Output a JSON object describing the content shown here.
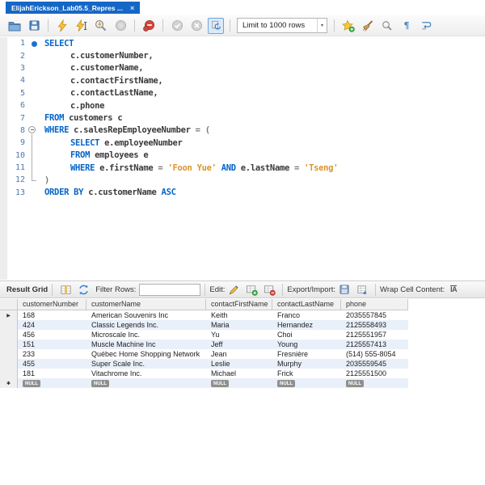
{
  "colors": {
    "tab_blue": "#1567c5",
    "keyword_blue": "#0564c8",
    "string_orange": "#d9952f",
    "alt_row_blue": "#e9f0fa",
    "lightning_yellow": "#f8c93f",
    "null_badge_gray": "#8f8f8f"
  },
  "tab": {
    "title": "ElijahErickson_Lab05.5_Repres ...",
    "close_glyph": "×"
  },
  "main_toolbar": {
    "limit_dropdown": {
      "value": "Limit to 1000 rows",
      "arrow_glyph": "▾"
    },
    "pilcrow_glyph": "¶",
    "icons": [
      "open-script-icon",
      "save-script-icon",
      "execute-icon",
      "execute-current-icon",
      "explain-icon",
      "stop-icon",
      "toggle-stop-on-error-icon",
      "commit-icon",
      "rollback-icon",
      "toggle-autocommit-icon",
      "save-snippet-icon",
      "beautify-icon",
      "find-icon",
      "show-invisibles-icon",
      "toggle-wrap-icon"
    ]
  },
  "editor": {
    "lines": [
      {
        "n": "1",
        "indent": 0,
        "marker": "statement",
        "segs": [
          [
            "SELECT",
            "kw"
          ]
        ]
      },
      {
        "n": "2",
        "indent": 1,
        "marker": "",
        "segs": [
          [
            "c.customerNumber,",
            "idn"
          ]
        ]
      },
      {
        "n": "3",
        "indent": 1,
        "marker": "",
        "segs": [
          [
            "c.customerName,",
            "idn"
          ]
        ]
      },
      {
        "n": "4",
        "indent": 1,
        "marker": "",
        "segs": [
          [
            "c.contactFirstName,",
            "idn"
          ]
        ]
      },
      {
        "n": "5",
        "indent": 1,
        "marker": "",
        "segs": [
          [
            "c.contactLastName,",
            "idn"
          ]
        ]
      },
      {
        "n": "6",
        "indent": 1,
        "marker": "",
        "segs": [
          [
            "c.phone",
            "idn"
          ]
        ]
      },
      {
        "n": "7",
        "indent": 0,
        "marker": "",
        "segs": [
          [
            "FROM",
            "kw"
          ],
          [
            " customers c",
            "idn"
          ]
        ]
      },
      {
        "n": "8",
        "indent": 0,
        "marker": "fold-start",
        "segs": [
          [
            "WHERE",
            "kw"
          ],
          [
            " c.salesRepEmployeeNumber ",
            "idn"
          ],
          [
            "= (",
            "op"
          ]
        ]
      },
      {
        "n": "9",
        "indent": 1,
        "marker": "fold-mid",
        "segs": [
          [
            "SELECT",
            "kw"
          ],
          [
            " e.employeeNumber",
            "idn"
          ]
        ]
      },
      {
        "n": "10",
        "indent": 1,
        "marker": "fold-mid",
        "segs": [
          [
            "FROM",
            "kw"
          ],
          [
            " employees e",
            "idn"
          ]
        ]
      },
      {
        "n": "11",
        "indent": 1,
        "marker": "fold-mid",
        "segs": [
          [
            "WHERE",
            "kw"
          ],
          [
            " e.firstName ",
            "idn"
          ],
          [
            "= ",
            "op"
          ],
          [
            "'Foon Yue'",
            "str"
          ],
          [
            " ",
            "idn"
          ],
          [
            "AND",
            "kw"
          ],
          [
            " e.lastName ",
            "idn"
          ],
          [
            "= ",
            "op"
          ],
          [
            "'Tseng'",
            "str"
          ]
        ]
      },
      {
        "n": "12",
        "indent": 0,
        "marker": "fold-end",
        "segs": [
          [
            ")",
            "op"
          ]
        ]
      },
      {
        "n": "13",
        "indent": 0,
        "marker": "",
        "segs": [
          [
            "ORDER BY",
            "kw"
          ],
          [
            " c.customerName ",
            "idn"
          ],
          [
            "ASC",
            "kw"
          ]
        ]
      }
    ]
  },
  "result_toolbar": {
    "title": "Result Grid",
    "filter_label": "Filter Rows:",
    "filter_value": "",
    "edit_label": "Edit:",
    "export_label": "Export/Import:",
    "wrap_label": "Wrap Cell Content:",
    "wrap_icon_text": "IA",
    "icons": [
      "grid-icon",
      "refresh-icon",
      "edit-pencil-icon",
      "insert-row-icon",
      "delete-row-icon",
      "export-icon",
      "import-icon",
      "wrap-cell-content-icon"
    ]
  },
  "grid": {
    "columns": [
      "customerNumber",
      "customerName",
      "contactFirstName",
      "contactLastName",
      "phone"
    ],
    "rows": [
      {
        "marker": "current-row",
        "cells": [
          "168",
          "American Souvenirs Inc",
          "Keith",
          "Franco",
          "2035557845"
        ]
      },
      {
        "marker": "",
        "cells": [
          "424",
          "Classic Legends Inc.",
          "Maria",
          "Hernandez",
          "2125558493"
        ]
      },
      {
        "marker": "",
        "cells": [
          "456",
          "Microscale Inc.",
          "Yu",
          "Choi",
          "2125551957"
        ]
      },
      {
        "marker": "",
        "cells": [
          "151",
          "Muscle Machine Inc",
          "Jeff",
          "Young",
          "2125557413"
        ]
      },
      {
        "marker": "",
        "cells": [
          "233",
          "Québec Home Shopping Network",
          "Jean",
          "Fresnière",
          "(514) 555-8054"
        ]
      },
      {
        "marker": "",
        "cells": [
          "455",
          "Super Scale Inc.",
          "Leslie",
          "Murphy",
          "2035559545"
        ]
      },
      {
        "marker": "",
        "cells": [
          "181",
          "Vitachrome Inc.",
          "Michael",
          "Frick",
          "2125551500"
        ]
      },
      {
        "marker": "new-row",
        "null_row": true,
        "cells": [
          "NULL",
          "NULL",
          "NULL",
          "NULL",
          "NULL"
        ]
      }
    ],
    "current_row_glyph": "▶",
    "new_row_glyph": "✱"
  }
}
